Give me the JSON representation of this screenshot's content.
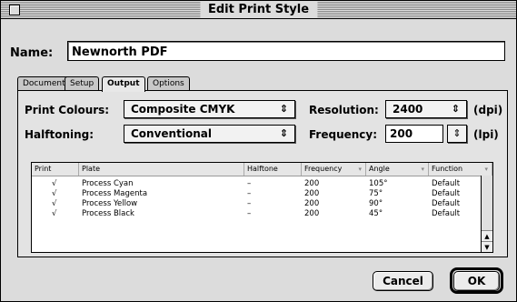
{
  "window": {
    "title": "Edit Print Style"
  },
  "name": {
    "label": "Name:",
    "value": "Newnorth PDF"
  },
  "tabs": [
    {
      "label": "Document",
      "active": false
    },
    {
      "label": "Setup",
      "active": false
    },
    {
      "label": "Output",
      "active": true
    },
    {
      "label": "Options",
      "active": false
    }
  ],
  "output": {
    "print_colours": {
      "label": "Print Colours:",
      "value": "Composite CMYK"
    },
    "halftoning": {
      "label": "Halftoning:",
      "value": "Conventional"
    },
    "resolution": {
      "label": "Resolution:",
      "value": "2400",
      "unit": "(dpi)"
    },
    "frequency": {
      "label": "Frequency:",
      "value": "200",
      "unit": "(lpi)"
    }
  },
  "table": {
    "headers": [
      "Print",
      "Plate",
      "Halftone",
      "Frequency",
      "Angle",
      "Function"
    ],
    "rows": [
      {
        "print": "√",
        "plate": "Process Cyan",
        "halftone": "–",
        "frequency": "200",
        "angle": "105°",
        "function": "Default"
      },
      {
        "print": "√",
        "plate": "Process Magenta",
        "halftone": "–",
        "frequency": "200",
        "angle": "75°",
        "function": "Default"
      },
      {
        "print": "√",
        "plate": "Process Yellow",
        "halftone": "–",
        "frequency": "200",
        "angle": "90°",
        "function": "Default"
      },
      {
        "print": "√",
        "plate": "Process Black",
        "halftone": "–",
        "frequency": "200",
        "angle": "45°",
        "function": "Default"
      }
    ]
  },
  "buttons": {
    "cancel": "Cancel",
    "ok": "OK"
  },
  "icons": {
    "popup_arrows": "⇕",
    "sort": "▾"
  }
}
